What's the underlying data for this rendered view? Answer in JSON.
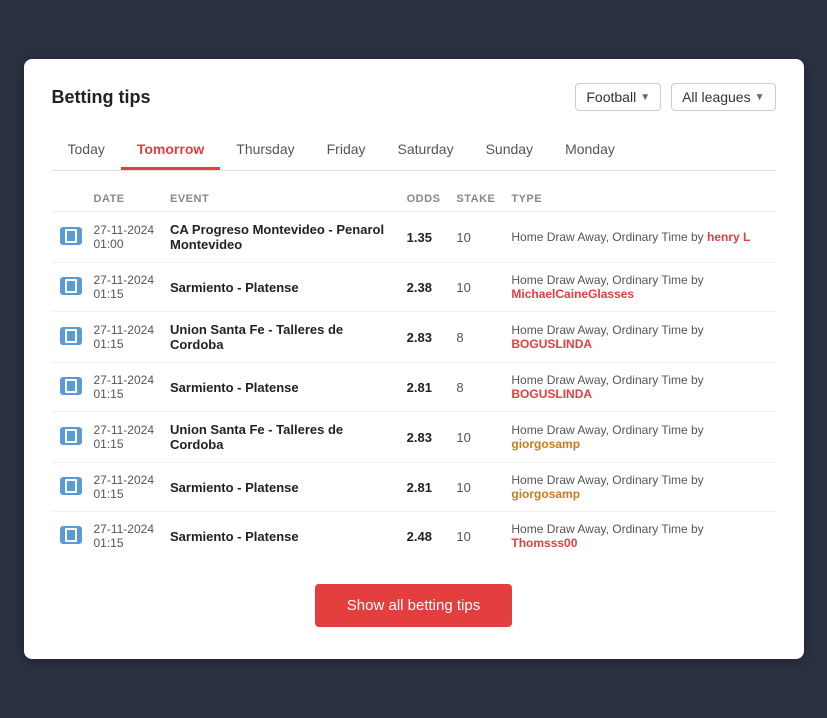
{
  "header": {
    "title": "Betting tips",
    "filter_sport_label": "Football",
    "filter_leagues_label": "All leagues"
  },
  "tabs": [
    {
      "label": "Today",
      "active": false
    },
    {
      "label": "Tomorrow",
      "active": true
    },
    {
      "label": "Thursday",
      "active": false
    },
    {
      "label": "Friday",
      "active": false
    },
    {
      "label": "Saturday",
      "active": false
    },
    {
      "label": "Sunday",
      "active": false
    },
    {
      "label": "Monday",
      "active": false
    }
  ],
  "table": {
    "columns": [
      "DATE",
      "EVENT",
      "ODDS",
      "STAKE",
      "TYPE"
    ],
    "rows": [
      {
        "date": "27-11-2024",
        "time": "01:00",
        "event": "CA Progreso Montevideo - Penarol Montevideo",
        "odds": "1.35",
        "stake": "10",
        "type_prefix": "Home Draw Away, Ordinary Time by ",
        "user": "henry L",
        "user_color": "red"
      },
      {
        "date": "27-11-2024",
        "time": "01:15",
        "event": "Sarmiento - Platense",
        "odds": "2.38",
        "stake": "10",
        "type_prefix": "Home Draw Away, Ordinary Time by ",
        "user": "MichaelCaineGlasses",
        "user_color": "red"
      },
      {
        "date": "27-11-2024",
        "time": "01:15",
        "event": "Union Santa Fe - Talleres de Cordoba",
        "odds": "2.83",
        "stake": "8",
        "type_prefix": "Home Draw Away, Ordinary Time by ",
        "user": "BOGUSLINDA",
        "user_color": "red"
      },
      {
        "date": "27-11-2024",
        "time": "01:15",
        "event": "Sarmiento - Platense",
        "odds": "2.81",
        "stake": "8",
        "type_prefix": "Home Draw Away, Ordinary Time by ",
        "user": "BOGUSLINDA",
        "user_color": "red"
      },
      {
        "date": "27-11-2024",
        "time": "01:15",
        "event": "Union Santa Fe - Talleres de Cordoba",
        "odds": "2.83",
        "stake": "10",
        "type_prefix": "Home Draw Away, Ordinary Time by ",
        "user": "giorgosamp",
        "user_color": "orange"
      },
      {
        "date": "27-11-2024",
        "time": "01:15",
        "event": "Sarmiento - Platense",
        "odds": "2.81",
        "stake": "10",
        "type_prefix": "Home Draw Away, Ordinary Time by ",
        "user": "giorgosamp",
        "user_color": "orange"
      },
      {
        "date": "27-11-2024",
        "time": "01:15",
        "event": "Sarmiento - Platense",
        "odds": "2.48",
        "stake": "10",
        "type_prefix": "Home Draw Away, Ordinary Time by ",
        "user": "Thomsss00",
        "user_color": "red"
      }
    ]
  },
  "show_button": "Show all betting tips"
}
